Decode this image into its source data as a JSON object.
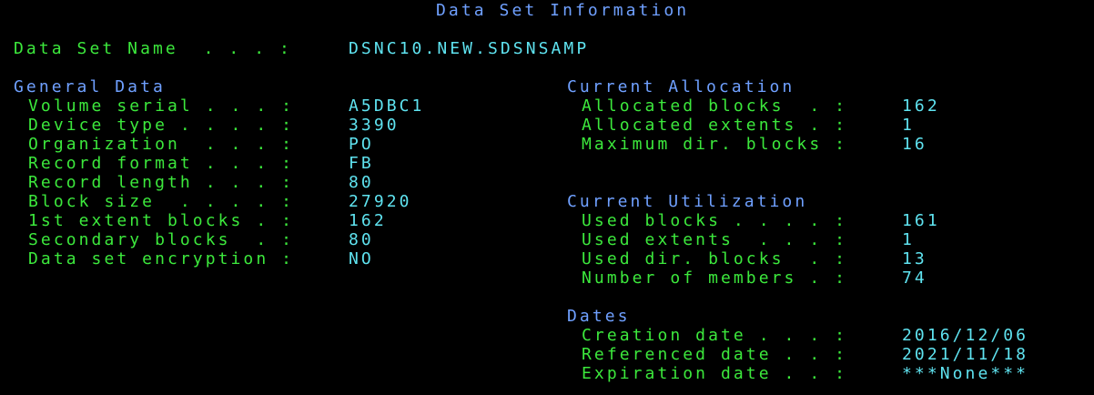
{
  "screen_title": "Data Set Information",
  "dataset": {
    "label": "Data Set Name  . . . :",
    "value": "DSNC10.NEW.SDSNSAMP"
  },
  "general_data": {
    "heading": "General Data",
    "fields": [
      {
        "label": "Volume serial . . . :",
        "value": "A5DBC1"
      },
      {
        "label": "Device type . . . . :",
        "value": "3390"
      },
      {
        "label": "Organization  . . . :",
        "value": "PO"
      },
      {
        "label": "Record format . . . :",
        "value": "FB"
      },
      {
        "label": "Record length . . . :",
        "value": "80"
      },
      {
        "label": "Block size  . . . . :",
        "value": "27920"
      },
      {
        "label": "1st extent blocks . :",
        "value": "162"
      },
      {
        "label": "Secondary blocks  . :",
        "value": "80"
      },
      {
        "label": "Data set encryption :",
        "value": "NO"
      }
    ]
  },
  "current_allocation": {
    "heading": "Current Allocation",
    "fields": [
      {
        "label": "Allocated blocks  . :",
        "value": "162"
      },
      {
        "label": "Allocated extents . :",
        "value": "1"
      },
      {
        "label": "Maximum dir. blocks :",
        "value": "16"
      }
    ]
  },
  "current_utilization": {
    "heading": "Current Utilization",
    "fields": [
      {
        "label": "Used blocks . . . . :",
        "value": "161"
      },
      {
        "label": "Used extents  . . . :",
        "value": "1"
      },
      {
        "label": "Used dir. blocks  . :",
        "value": "13"
      },
      {
        "label": "Number of members . :",
        "value": "74"
      }
    ]
  },
  "dates": {
    "heading": "Dates",
    "fields": [
      {
        "label": "Creation date . . . :",
        "value": "2016/12/06"
      },
      {
        "label": "Referenced date . . :",
        "value": "2021/11/18"
      },
      {
        "label": "Expiration date . . :",
        "value": "***None***"
      }
    ]
  },
  "colors": {
    "background": "#000000",
    "field_label": "#3CE83C",
    "field_value": "#5FE3F0",
    "section_heading": "#6FA0FF"
  }
}
